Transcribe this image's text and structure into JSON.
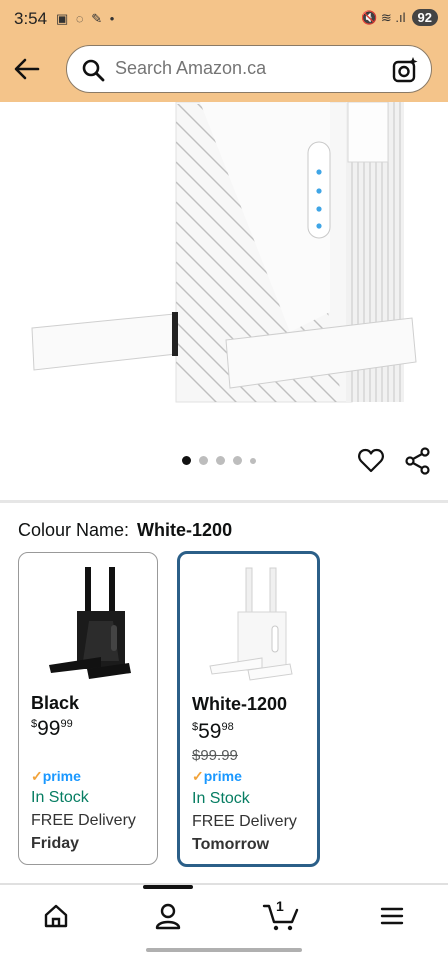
{
  "status": {
    "time": "3:54",
    "left_icons": "▣ ◌ ✎ •",
    "right_icons": "🔇 ≋ .ıl",
    "battery": "92"
  },
  "search": {
    "placeholder": "Search Amazon.ca"
  },
  "colour": {
    "label": "Colour Name:",
    "selected": "White-1200"
  },
  "variants": [
    {
      "name": "Black",
      "price_symbol": "$",
      "price_whole": "99",
      "price_frac": "99",
      "old_price": "",
      "prime": "prime",
      "stock": "In Stock",
      "delivery": "FREE Delivery",
      "day": "Friday"
    },
    {
      "name": "White-1200",
      "price_symbol": "$",
      "price_whole": "59",
      "price_frac": "98",
      "old_price": "$99.99",
      "prime": "prime",
      "stock": "In Stock",
      "delivery": "FREE Delivery",
      "day": "Tomorrow"
    }
  ],
  "carousel": {
    "count": 5,
    "active_index": 0
  },
  "cart": {
    "count": "1"
  },
  "colors": {
    "header_bg": "#f4c48a",
    "prime_blue": "#1a98ff",
    "in_stock_green": "#067d62",
    "selected_border": "#2b5f88"
  }
}
